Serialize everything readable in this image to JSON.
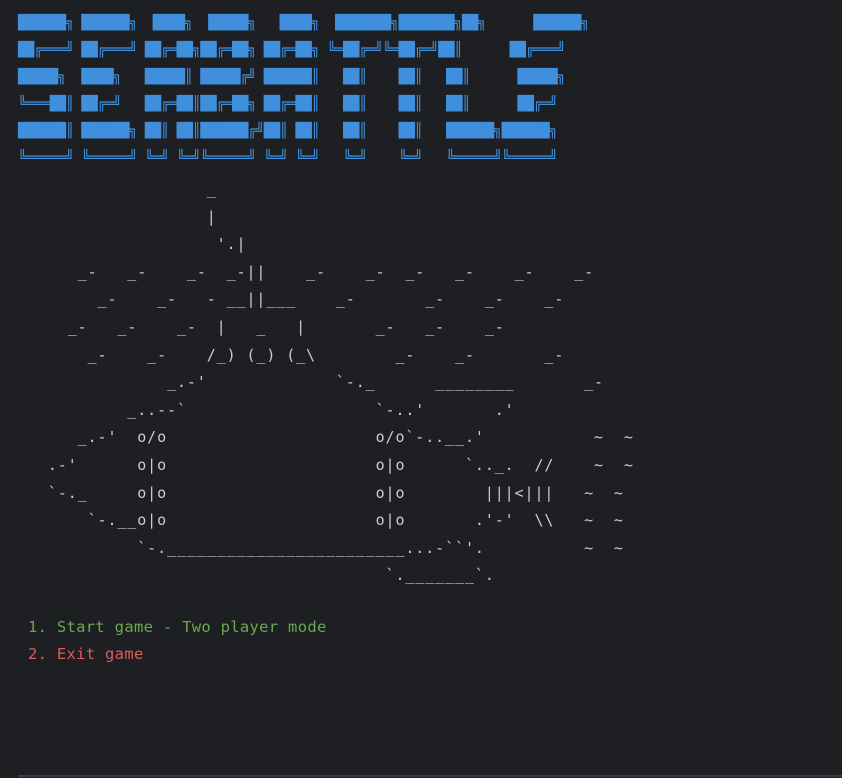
{
  "title_art": "██████╗ ██████╗  ████╗  █████╗   ████╗  ███████╗███████╗██╗      ██████╗\n██╔═══╝ ██╔═══╝ ██╔═██╗██╔═██╗ ██╔═██╗ ╚═██╔═╝╚═██╔═╝██║      ██╔═══╝\n█████╗  ████╗   █████║ █████╔╝ ██████║   ██║    ██║   ██║      █████╗\n╚═══██║ ██╔═╝   ██╔═██║██╔═██╗ ██╔═██║   ██║    ██║   ██║      ██╔═╝\n██████║ ██████╗ ██║ ██║██████╔╝██║ ██║   ██║    ██║   ██████╗██████╗\n╚═════╝ ╚═════╝ ╚═╝ ╚═╝╚═════╝ ╚═╝ ╚═╝   ╚═╝    ╚═╝   ╚═════╝╚═════╝",
  "ship_art": "                  _\n                  |\n                   '.|\n     _-   _-    _-  _-||    _-    _-  _-   _-    _-    _-\n       _-    _-   - __||___    _-       _-    _-    _-\n    _-   _-    _-  |   _   |       _-   _-    _-\n      _-    _-    /_) (_) (_\\        _-    _-       _-\n              _.-'             `-._      ________       _-\n          _..--`                   `-..'       .'\n     _.-'  o/o                     o/o`-..__.'           ~  ~\n  .-'      o|o                     o|o      `.._.  //    ~  ~\n  `-._     o|o                     o|o        |||<|||   ~  ~\n      `-.__o|o                     o|o       .'-'  \\\\   ~  ~\n           `-.________________________...-``'.          ~  ~\n                                    `._______`.",
  "menu": {
    "option1": "1. Start game - Two player mode",
    "option2": "2. Exit game"
  },
  "colors": {
    "background": "#1e1f22",
    "title": "#3f8fdc",
    "art": "#c9ccd3",
    "start_option": "#6aa84f",
    "exit_option": "#e05a5a"
  }
}
